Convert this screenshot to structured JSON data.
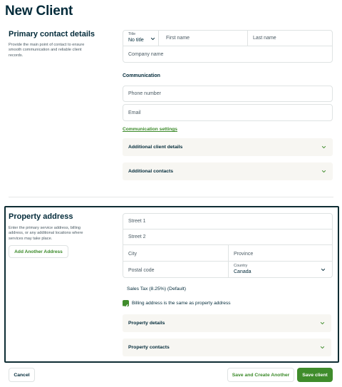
{
  "page": {
    "title": "New Client"
  },
  "primary_contact": {
    "title": "Primary contact details",
    "description": "Provide the main point of contact to ensure smooth communication and reliable client records.",
    "title_field": {
      "label": "Title",
      "value": "No title"
    },
    "first_name_placeholder": "First name",
    "last_name_placeholder": "Last name",
    "company_placeholder": "Company name"
  },
  "communication": {
    "heading": "Communication",
    "phone_placeholder": "Phone number",
    "email_placeholder": "Email",
    "settings_link": "Communication settings"
  },
  "accordions": {
    "client_details": "Additional client details",
    "contacts": "Additional contacts",
    "property_details": "Property details",
    "property_contacts": "Property contacts"
  },
  "property": {
    "title": "Property address",
    "description": "Enter the primary service address, billing address, or any additional locations where services may take place.",
    "add_address": "Add Another Address",
    "street1_placeholder": "Street 1",
    "street2_placeholder": "Street 2",
    "city_placeholder": "City",
    "province_placeholder": "Province",
    "postal_placeholder": "Postal code",
    "country": {
      "label": "Country",
      "value": "Canada"
    },
    "tax": "Sales Tax (8.25%) (Default)",
    "billing_same": "Billing address is the same as property address",
    "billing_same_checked": true
  },
  "footer": {
    "cancel": "Cancel",
    "save_create_another": "Save and Create Another",
    "save": "Save client"
  },
  "colors": {
    "brand_green": "#3f8c2b",
    "link_green": "#3b8a29",
    "text_navy": "#032b3a",
    "accordion_bg": "#f7f6f2",
    "border": "#dfe3e3"
  }
}
